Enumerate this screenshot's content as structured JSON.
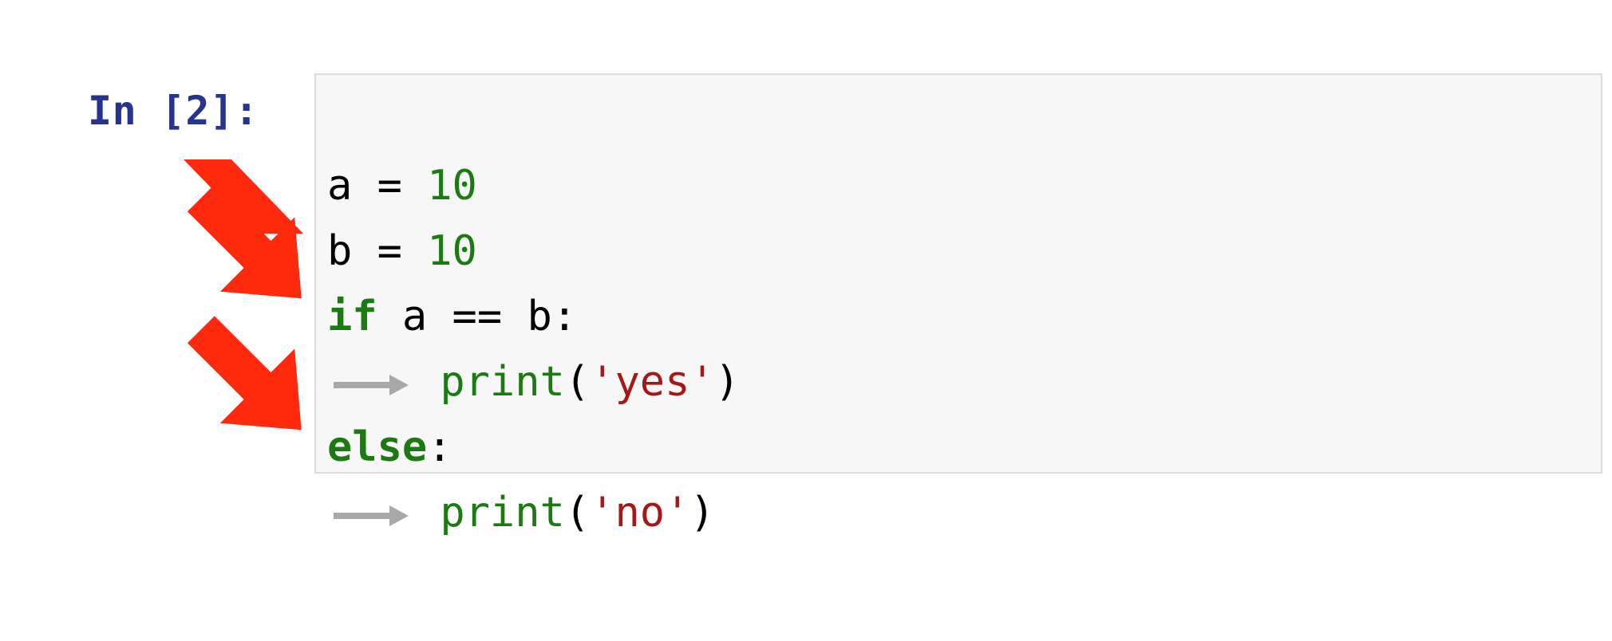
{
  "prompt": {
    "label": "In [2]:"
  },
  "code": {
    "line1": {
      "a": "a = ",
      "val": "10"
    },
    "line2": {
      "a": "b = ",
      "val": "10"
    },
    "line3": {
      "kw": "if",
      "rest": " a == b:"
    },
    "line4": {
      "func": "print",
      "paren_open": "(",
      "str": "'yes'",
      "paren_close": ")"
    },
    "line5": {
      "kw": "else",
      "colon": ":"
    },
    "line6": {
      "func": "print",
      "paren_open": "(",
      "str": "'no'",
      "paren_close": ")"
    }
  },
  "annotations": {
    "arrow_color": "#ff2a0e",
    "indent_arrow_color": "#a8a8a8"
  }
}
